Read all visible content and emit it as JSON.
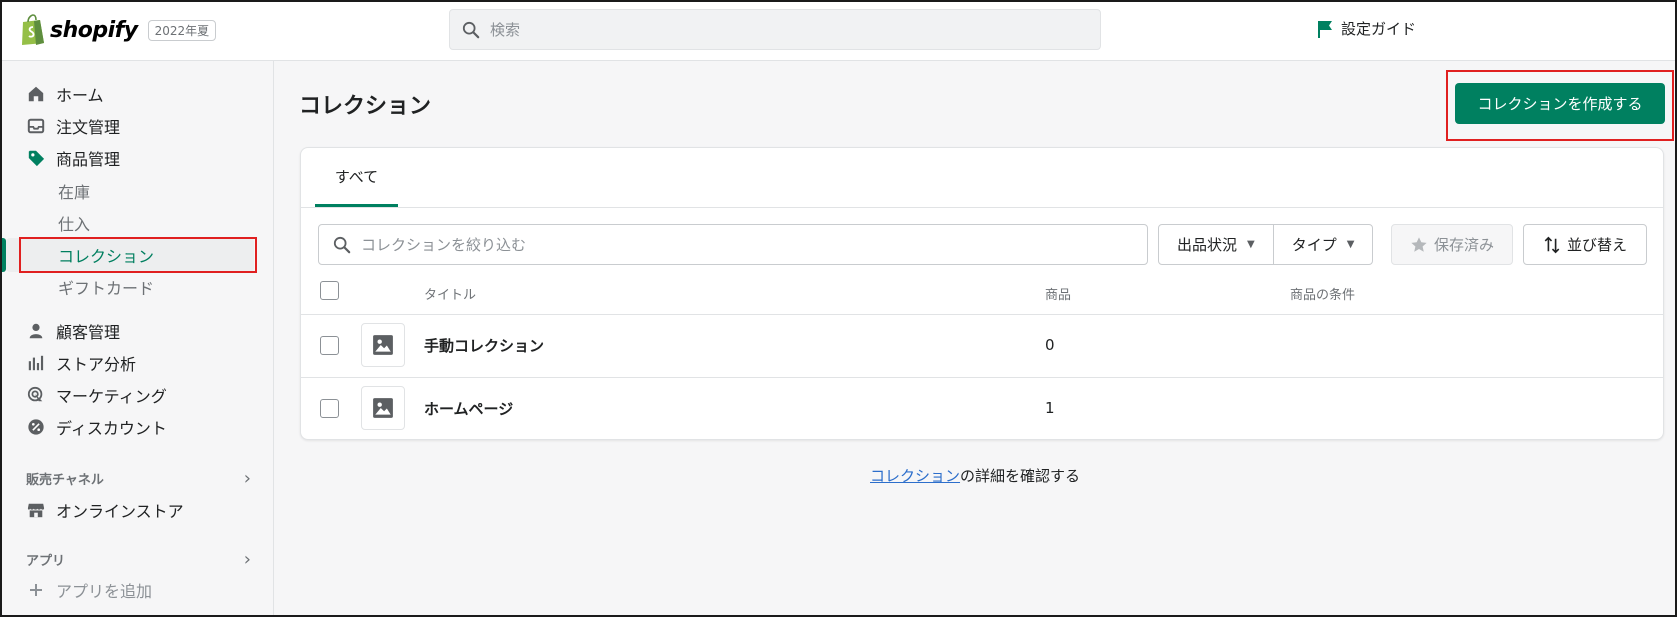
{
  "header": {
    "brand": "shopify",
    "edition": "2022年夏",
    "search_placeholder": "検索",
    "setup_guide": "設定ガイド"
  },
  "sidebar": {
    "items": [
      {
        "label": "ホーム",
        "icon": "home-icon"
      },
      {
        "label": "注文管理",
        "icon": "inbox-icon"
      },
      {
        "label": "商品管理",
        "icon": "tag-icon"
      }
    ],
    "product_sub": [
      "在庫",
      "仕入",
      "コレクション",
      "ギフトカード"
    ],
    "items2": [
      {
        "label": "顧客管理",
        "icon": "person-icon"
      },
      {
        "label": "ストア分析",
        "icon": "analytics-icon"
      },
      {
        "label": "マーケティング",
        "icon": "marketing-icon"
      },
      {
        "label": "ディスカウント",
        "icon": "discount-icon"
      }
    ],
    "sales_channels_heading": "販売チャネル",
    "online_store": "オンラインストア",
    "apps_heading": "アプリ",
    "add_app": "アプリを追加"
  },
  "page": {
    "title": "コレクション",
    "create_button": "コレクションを作成する",
    "tab_all": "すべて",
    "filter_placeholder": "コレクションを絞り込む",
    "filter_status": "出品状況",
    "filter_type": "タイプ",
    "saved": "保存済み",
    "sort": "並び替え",
    "columns": [
      "タイトル",
      "商品",
      "商品の条件"
    ],
    "rows": [
      {
        "title": "手動コレクション",
        "count": "0"
      },
      {
        "title": "ホームページ",
        "count": "1"
      }
    ],
    "learn_link": "コレクション",
    "learn_suffix": "の詳細を確認する"
  },
  "colors": {
    "accent": "#008060",
    "highlight": "#e02020",
    "link": "#2c6ecb"
  }
}
